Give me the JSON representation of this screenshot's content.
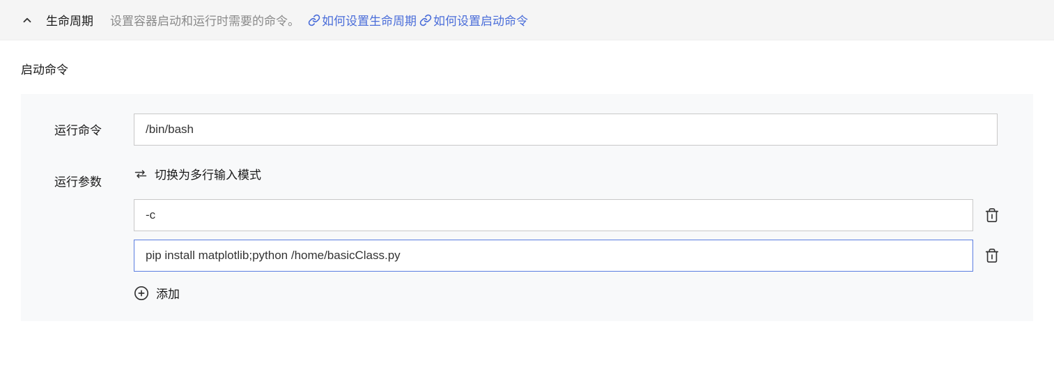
{
  "panel": {
    "title": "生命周期",
    "description": "设置容器启动和运行时需要的命令。",
    "help_links": [
      {
        "label": "如何设置生命周期"
      },
      {
        "label": "如何设置启动命令"
      }
    ]
  },
  "section": {
    "title": "启动命令"
  },
  "form": {
    "command_label": "运行命令",
    "command_value": "/bin/bash",
    "params_label": "运行参数",
    "toggle_mode_text": "切换为多行输入模式",
    "params": [
      {
        "value": "-c"
      },
      {
        "value": "pip install matplotlib;python /home/basicClass.py"
      }
    ],
    "add_label": "添加"
  }
}
